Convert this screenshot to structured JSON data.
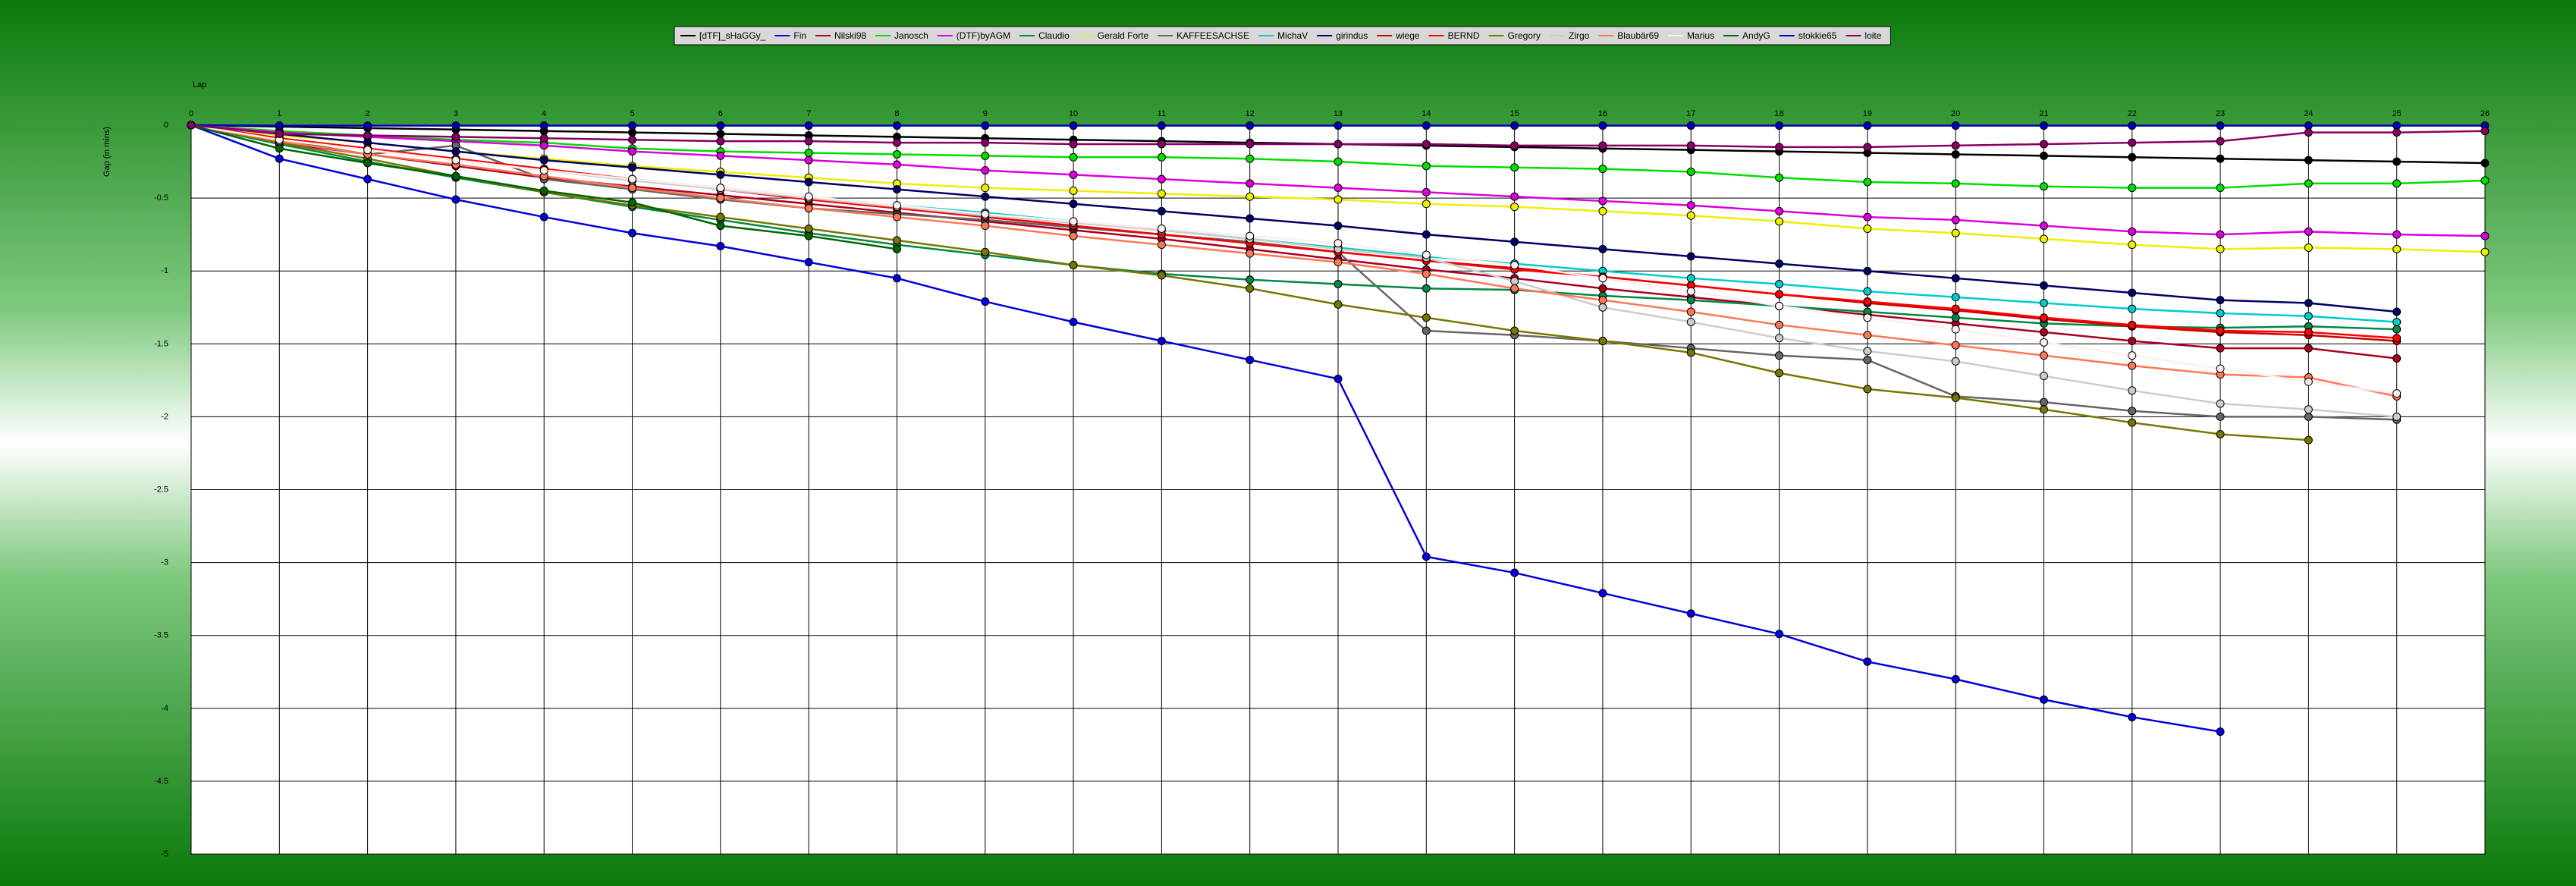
{
  "chart_data": {
    "type": "line",
    "xlabel": "Lap",
    "ylabel": "Gap (in mins)",
    "xlim": [
      0,
      26
    ],
    "ylim": [
      -5,
      0
    ],
    "x_ticks": [
      "0",
      "1",
      "2",
      "3",
      "4",
      "5",
      "6",
      "7",
      "8",
      "9",
      "10",
      "11",
      "12",
      "13",
      "14",
      "15",
      "16",
      "17",
      "18",
      "19",
      "20",
      "21",
      "22",
      "23",
      "24",
      "25",
      "26"
    ],
    "y_ticks": [
      "0",
      "-0.5",
      "-1",
      "-1.5",
      "-2",
      "-2.5",
      "-3",
      "-3.5",
      "-4",
      "-4.5",
      "-5"
    ],
    "legend_position": "top-center",
    "grid": true,
    "series": [
      {
        "name": "[dTF]_sHaGGy_",
        "color": "#000000",
        "values": [
          0,
          -0.01,
          -0.02,
          -0.03,
          -0.04,
          -0.05,
          -0.06,
          -0.07,
          -0.08,
          -0.09,
          -0.1,
          -0.11,
          -0.12,
          -0.13,
          -0.14,
          -0.15,
          -0.16,
          -0.17,
          -0.18,
          -0.19,
          -0.2,
          -0.21,
          -0.22,
          -0.23,
          -0.24,
          -0.25,
          -0.26
        ]
      },
      {
        "name": "Fin",
        "color": "#0000dd",
        "values": [
          0,
          -0.23,
          -0.37,
          -0.51,
          -0.63,
          -0.74,
          -0.83,
          -0.94,
          -1.05,
          -1.21,
          -1.35,
          -1.48,
          -1.61,
          -1.74,
          -2.96,
          -3.07,
          -3.21,
          -3.35,
          -3.49,
          -3.68,
          -3.8,
          -3.94,
          -4.06,
          -4.16
        ]
      },
      {
        "name": "Nilski98",
        "color": "#aa0022",
        "values": [
          0,
          -0.12,
          -0.2,
          -0.28,
          -0.36,
          -0.42,
          -0.48,
          -0.54,
          -0.6,
          -0.66,
          -0.72,
          -0.78,
          -0.85,
          -0.92,
          -0.99,
          -1.05,
          -1.12,
          -1.18,
          -1.24,
          -1.3,
          -1.36,
          -1.42,
          -1.48,
          -1.53,
          -1.53,
          -1.6
        ]
      },
      {
        "name": "Janosch",
        "color": "#00dd00",
        "values": [
          0,
          -0.04,
          -0.07,
          -0.1,
          -0.12,
          -0.16,
          -0.18,
          -0.19,
          -0.2,
          -0.21,
          -0.22,
          -0.22,
          -0.23,
          -0.25,
          -0.28,
          -0.29,
          -0.3,
          -0.32,
          -0.36,
          -0.39,
          -0.4,
          -0.42,
          -0.43,
          -0.43,
          -0.4,
          -0.4,
          -0.38
        ]
      },
      {
        "name": "(DTF)byAGM",
        "color": "#dd00dd",
        "values": [
          0,
          -0.05,
          -0.08,
          -0.11,
          -0.14,
          -0.18,
          -0.21,
          -0.24,
          -0.27,
          -0.31,
          -0.34,
          -0.37,
          -0.4,
          -0.43,
          -0.46,
          -0.49,
          -0.52,
          -0.55,
          -0.59,
          -0.63,
          -0.65,
          -0.69,
          -0.73,
          -0.75,
          -0.73,
          -0.75,
          -0.76
        ]
      },
      {
        "name": "Claudio",
        "color": "#008844",
        "values": [
          0,
          -0.13,
          -0.25,
          -0.36,
          -0.46,
          -0.56,
          -0.65,
          -0.74,
          -0.82,
          -0.89,
          -0.96,
          -1.02,
          -1.06,
          -1.09,
          -1.12,
          -1.13,
          -1.17,
          -1.2,
          -1.24,
          -1.28,
          -1.32,
          -1.36,
          -1.38,
          -1.39,
          -1.38,
          -1.4
        ]
      },
      {
        "name": "Gerald Forte",
        "color": "#eeee00",
        "values": [
          0,
          -0.07,
          -0.12,
          -0.18,
          -0.23,
          -0.28,
          -0.32,
          -0.36,
          -0.4,
          -0.43,
          -0.45,
          -0.47,
          -0.49,
          -0.51,
          -0.54,
          -0.56,
          -0.59,
          -0.62,
          -0.66,
          -0.71,
          -0.74,
          -0.78,
          -0.82,
          -0.85,
          -0.84,
          -0.85,
          -0.87
        ]
      },
      {
        "name": "KAFFEESACHSE",
        "color": "#666666",
        "values": [
          0,
          -0.1,
          -0.2,
          -0.14,
          -0.37,
          -0.44,
          -0.51,
          -0.57,
          -0.61,
          -0.65,
          -0.7,
          -0.75,
          -0.8,
          -0.87,
          -1.41,
          -1.44,
          -1.48,
          -1.53,
          -1.58,
          -1.61,
          -1.86,
          -1.9,
          -1.96,
          -2.0,
          -2.0,
          -2.02
        ]
      },
      {
        "name": "MichaV",
        "color": "#00cccc",
        "values": [
          0,
          -0.09,
          -0.16,
          -0.23,
          -0.3,
          -0.37,
          -0.43,
          -0.49,
          -0.55,
          -0.6,
          -0.66,
          -0.72,
          -0.78,
          -0.84,
          -0.9,
          -0.95,
          -1.0,
          -1.05,
          -1.09,
          -1.14,
          -1.18,
          -1.22,
          -1.26,
          -1.29,
          -1.31,
          -1.35
        ]
      },
      {
        "name": "girindus",
        "color": "#000066",
        "values": [
          0,
          -0.06,
          -0.12,
          -0.18,
          -0.24,
          -0.29,
          -0.34,
          -0.39,
          -0.44,
          -0.49,
          -0.54,
          -0.59,
          -0.64,
          -0.69,
          -0.75,
          -0.8,
          -0.85,
          -0.9,
          -0.95,
          -1.0,
          -1.05,
          -1.1,
          -1.15,
          -1.2,
          -1.22,
          -1.28
        ]
      },
      {
        "name": "wiege",
        "color": "#cc0000",
        "values": [
          0,
          -0.09,
          -0.16,
          -0.23,
          -0.3,
          -0.37,
          -0.44,
          -0.51,
          -0.57,
          -0.63,
          -0.69,
          -0.75,
          -0.81,
          -0.87,
          -0.93,
          -0.98,
          -1.04,
          -1.1,
          -1.16,
          -1.22,
          -1.27,
          -1.33,
          -1.38,
          -1.42,
          -1.44,
          -1.48
        ]
      },
      {
        "name": "BERND",
        "color": "#ff0000",
        "values": [
          0,
          -0.09,
          -0.16,
          -0.23,
          -0.3,
          -0.37,
          -0.44,
          -0.51,
          -0.57,
          -0.63,
          -0.69,
          -0.75,
          -0.81,
          -0.87,
          -0.93,
          -0.99,
          -1.04,
          -1.1,
          -1.16,
          -1.21,
          -1.26,
          -1.32,
          -1.37,
          -1.41,
          -1.42,
          -1.46
        ]
      },
      {
        "name": "Gregory",
        "color": "#777700",
        "values": [
          0,
          -0.12,
          -0.23,
          -0.35,
          -0.46,
          -0.55,
          -0.63,
          -0.71,
          -0.79,
          -0.87,
          -0.96,
          -1.03,
          -1.12,
          -1.23,
          -1.32,
          -1.41,
          -1.48,
          -1.56,
          -1.7,
          -1.81,
          -1.87,
          -1.95,
          -2.04,
          -2.12,
          -2.16
        ]
      },
      {
        "name": "Zirgo",
        "color": "#cccccc",
        "values": [
          0,
          -0.1,
          -0.17,
          -0.24,
          -0.31,
          -0.38,
          -0.44,
          -0.5,
          -0.56,
          -0.62,
          -0.67,
          -0.72,
          -0.78,
          -0.85,
          -0.91,
          -1.07,
          -1.25,
          -1.35,
          -1.46,
          -1.55,
          -1.62,
          -1.72,
          -1.82,
          -1.91,
          -1.95,
          -2.0
        ]
      },
      {
        "name": "Blaubär69",
        "color": "#ff7755",
        "values": [
          0,
          -0.11,
          -0.2,
          -0.27,
          -0.35,
          -0.43,
          -0.5,
          -0.57,
          -0.63,
          -0.69,
          -0.76,
          -0.82,
          -0.88,
          -0.94,
          -1.02,
          -1.12,
          -1.2,
          -1.28,
          -1.37,
          -1.44,
          -1.51,
          -1.58,
          -1.65,
          -1.71,
          -1.73,
          -1.86
        ]
      },
      {
        "name": "Marius",
        "color": "#ffeeee",
        "values": [
          0,
          -0.1,
          -0.17,
          -0.24,
          -0.31,
          -0.37,
          -0.43,
          -0.49,
          -0.55,
          -0.61,
          -0.66,
          -0.71,
          -0.76,
          -0.81,
          -0.89,
          -0.96,
          -1.05,
          -1.14,
          -1.24,
          -1.32,
          -1.4,
          -1.49,
          -1.58,
          -1.67,
          -1.76,
          -1.84
        ]
      },
      {
        "name": "AndyG",
        "color": "#006600",
        "values": [
          0,
          -0.16,
          -0.26,
          -0.35,
          -0.45,
          -0.53,
          -0.69,
          -0.76,
          -0.85
        ]
      },
      {
        "name": "stokkie65",
        "color": "#0000bb",
        "values": [
          0,
          -0.003,
          -0.003,
          -0.003,
          -0.003,
          -0.003,
          -0.003,
          -0.003,
          -0.003,
          -0.003,
          -0.003,
          -0.003,
          -0.003,
          -0.003,
          -0.003,
          -0.003,
          -0.003,
          -0.003,
          -0.003,
          -0.003,
          -0.003,
          -0.003,
          -0.003,
          -0.003,
          -0.003,
          -0.003,
          -0.003
        ]
      },
      {
        "name": "loite",
        "color": "#880066",
        "values": [
          0,
          -0.06,
          -0.07,
          -0.08,
          -0.09,
          -0.1,
          -0.11,
          -0.11,
          -0.12,
          -0.12,
          -0.13,
          -0.13,
          -0.13,
          -0.13,
          -0.13,
          -0.14,
          -0.14,
          -0.14,
          -0.15,
          -0.15,
          -0.14,
          -0.13,
          -0.12,
          -0.11,
          -0.05,
          -0.05,
          -0.04
        ]
      }
    ]
  }
}
